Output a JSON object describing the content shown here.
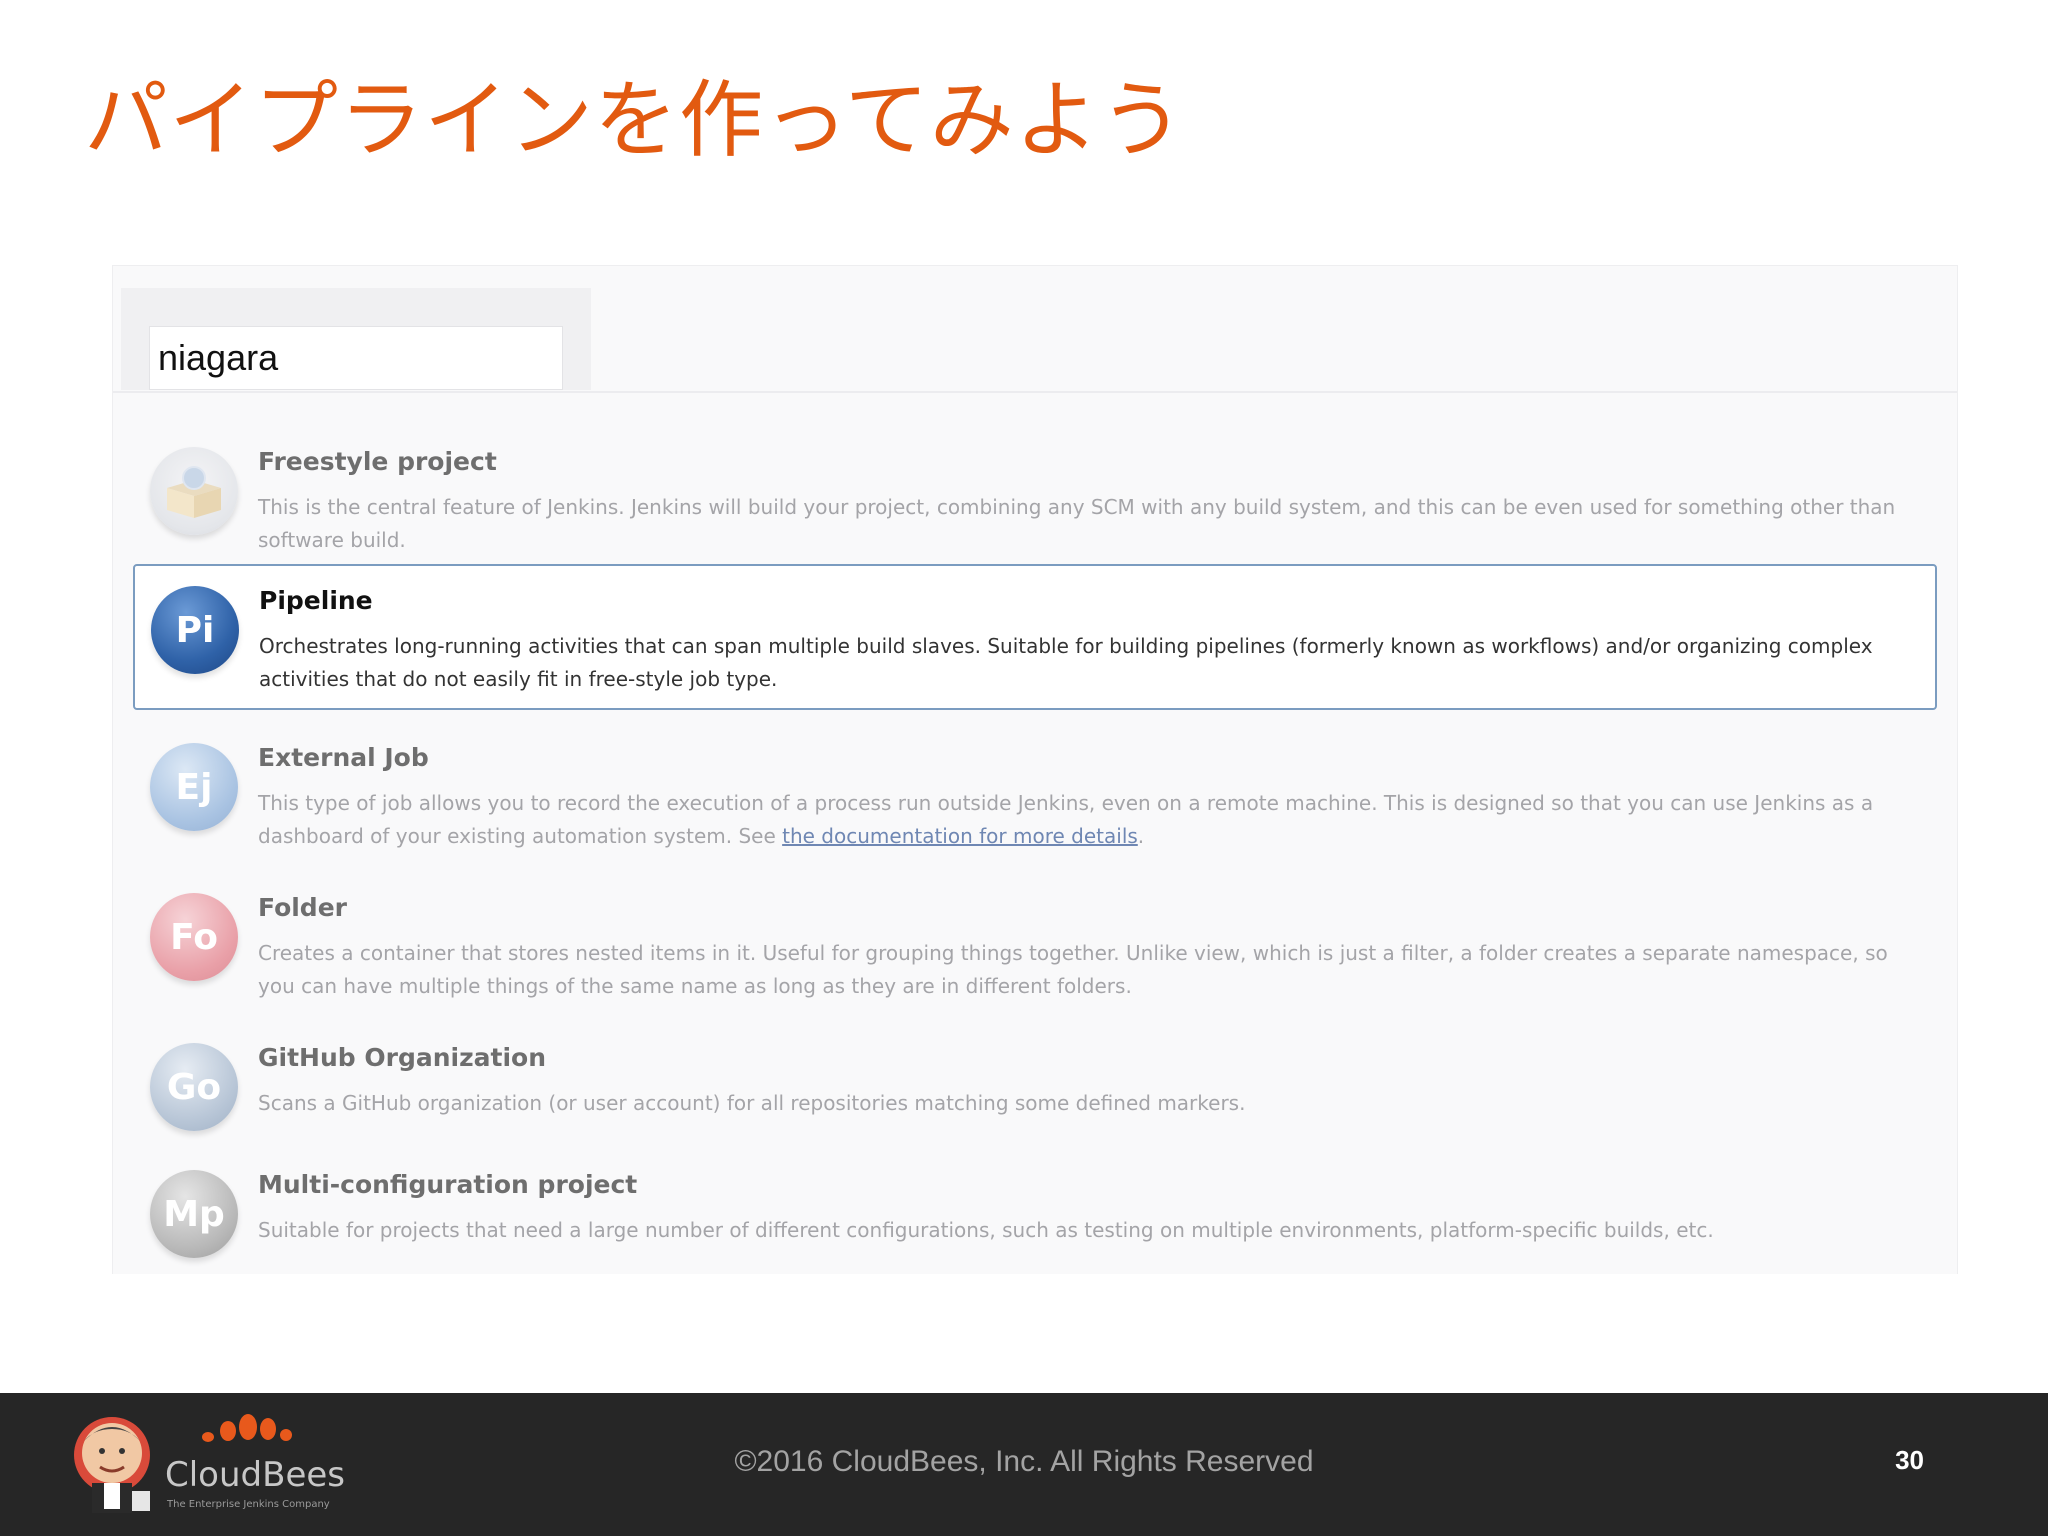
{
  "slide": {
    "title": "パイプラインを作ってみよう"
  },
  "form": {
    "item_name_value": "niagara"
  },
  "items": [
    {
      "title": "Freestyle project",
      "description": "This is the central feature of Jenkins. Jenkins will build your project, combining any SCM with any build system, and this can be even used for something other than software build.",
      "icon": "box-icon",
      "selected": false
    },
    {
      "title": "Pipeline",
      "description": "Orchestrates long-running activities that can span multiple build slaves. Suitable for building pipelines (formerly known as workflows) and/or organizing complex activities that do not easily fit in free-style job type.",
      "icon_text": "Pi",
      "selected": true
    },
    {
      "title": "External Job",
      "description": "This type of job allows you to record the execution of a process run outside Jenkins, even on a remote machine. This is designed so that you can use Jenkins as a dashboard of your existing automation system. See ",
      "link_text": "the documentation for more details",
      "description_end": ".",
      "icon_text": "Ej",
      "selected": false
    },
    {
      "title": "Folder",
      "description": "Creates a container that stores nested items in it. Useful for grouping things together. Unlike view, which is just a filter, a folder creates a separate namespace, so you can have multiple things of the same name as long as they are in different folders.",
      "icon_text": "Fo",
      "selected": false
    },
    {
      "title": "GitHub Organization",
      "description": "Scans a GitHub organization (or user account) for all repositories matching some defined markers.",
      "icon_text": "Go",
      "selected": false
    },
    {
      "title": "Multi-configuration project",
      "description": "Suitable for projects that need a large number of different configurations, such as testing on multiple environments, platform-specific builds, etc.",
      "icon_text": "Mp",
      "selected": false
    }
  ],
  "footer": {
    "logo_text": "CloudBees",
    "logo_tagline": "The Enterprise Jenkins Company",
    "copyright": "©2016 CloudBees, Inc. All Rights Reserved",
    "page_number": "30"
  },
  "colors": {
    "title_accent": "#e25a10",
    "selected_border": "#7b9cc0",
    "footer_bg": "#262626",
    "pipeline_icon": "#2f62a8",
    "external_job_icon": "#a9c3e2",
    "folder_icon": "#e9a0a8",
    "github_icon": "#b7c5d6",
    "multiconfig_icon": "#b8b8b8",
    "brand_orange": "#e8591c"
  }
}
